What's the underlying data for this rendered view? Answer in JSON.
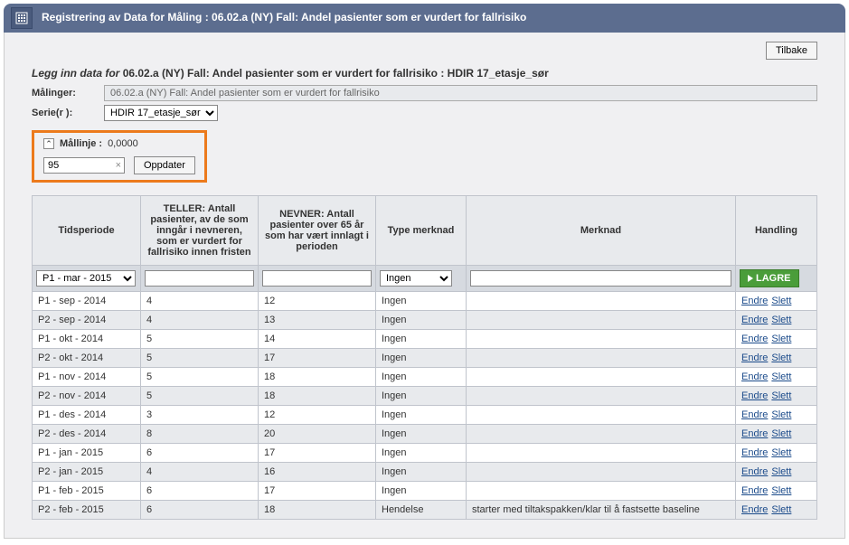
{
  "header": {
    "title": "Registrering av Data for Måling : 06.02.a (NY) Fall: Andel pasienter som er vurdert for fallrisiko"
  },
  "buttons": {
    "tilbake": "Tilbake",
    "oppdater": "Oppdater",
    "lagre": "LAGRE",
    "endre": "Endre",
    "slett": "Slett"
  },
  "subtitle": {
    "prefix": "Legg inn data for",
    "code": "06.02.a (NY) Fall: Andel pasienter som er vurdert for fallrisiko : HDIR 17_etasje_sør"
  },
  "form": {
    "malinger_label": "Målinger:",
    "malinger_value": "06.02.a (NY) Fall: Andel pasienter som er vurdert for fallrisiko",
    "serier_label": "Serie(r ):",
    "serier_value": "HDIR 17_etasje_sør",
    "mallinje_label": "Mållinje :",
    "mallinje_value": "0,0000",
    "mallinje_input": "95"
  },
  "table": {
    "headers": {
      "tidsperiode": "Tidsperiode",
      "teller": "TELLER: Antall pasienter, av de som inngår i nevneren, som er vurdert for fallrisiko innen fristen",
      "nevner": "NEVNER: Antall pasienter over 65 år som har vært innlagt i perioden",
      "type": "Type merknad",
      "merknad": "Merknad",
      "handling": "Handling"
    },
    "input_row": {
      "period": "P1 - mar - 2015",
      "type": "Ingen"
    },
    "rows": [
      {
        "period": "P1 - sep - 2014",
        "teller": "4",
        "nevner": "12",
        "type": "Ingen",
        "merknad": ""
      },
      {
        "period": "P2 - sep - 2014",
        "teller": "4",
        "nevner": "13",
        "type": "Ingen",
        "merknad": ""
      },
      {
        "period": "P1 - okt - 2014",
        "teller": "5",
        "nevner": "14",
        "type": "Ingen",
        "merknad": ""
      },
      {
        "period": "P2 - okt - 2014",
        "teller": "5",
        "nevner": "17",
        "type": "Ingen",
        "merknad": ""
      },
      {
        "period": "P1 - nov - 2014",
        "teller": "5",
        "nevner": "18",
        "type": "Ingen",
        "merknad": ""
      },
      {
        "period": "P2 - nov - 2014",
        "teller": "5",
        "nevner": "18",
        "type": "Ingen",
        "merknad": ""
      },
      {
        "period": "P1 - des - 2014",
        "teller": "3",
        "nevner": "12",
        "type": "Ingen",
        "merknad": ""
      },
      {
        "period": "P2 - des - 2014",
        "teller": "8",
        "nevner": "20",
        "type": "Ingen",
        "merknad": ""
      },
      {
        "period": "P1 - jan - 2015",
        "teller": "6",
        "nevner": "17",
        "type": "Ingen",
        "merknad": ""
      },
      {
        "period": "P2 - jan - 2015",
        "teller": "4",
        "nevner": "16",
        "type": "Ingen",
        "merknad": ""
      },
      {
        "period": "P1 - feb - 2015",
        "teller": "6",
        "nevner": "17",
        "type": "Ingen",
        "merknad": ""
      },
      {
        "period": "P2 - feb - 2015",
        "teller": "6",
        "nevner": "18",
        "type": "Hendelse",
        "merknad": "starter med tiltakspakken/klar til å fastsette baseline"
      }
    ]
  }
}
